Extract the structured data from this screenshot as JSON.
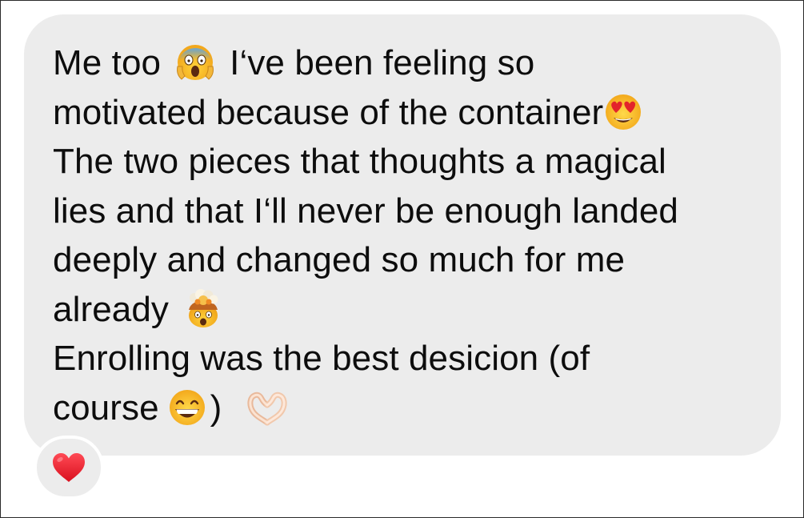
{
  "message": {
    "lines": [
      {
        "before": "Me too",
        "after": "I‘ve been feeling so"
      },
      {
        "text": "motivated because of the container"
      },
      {
        "text": "The two pieces that thoughts a magical"
      },
      {
        "text": "lies and that I‘ll never be enough landed"
      },
      {
        "text": "deeply and changed so much for me"
      },
      {
        "text": "already"
      },
      {
        "text": "Enrolling was the best desicion (of"
      },
      {
        "before": "course",
        "after": ")"
      }
    ],
    "emojis": {
      "line1": "screaming-face-emoji",
      "line2": "heart-eyes-emoji",
      "line6": "exploding-head-emoji",
      "line8_a": "grinning-face-emoji",
      "line8_b": "heart-hands-emoji"
    }
  },
  "reaction": {
    "icon": "red-heart-icon",
    "color": "#e8192c"
  },
  "colors": {
    "bubble": "#ececec",
    "text": "#0d0d0d",
    "background": "#ffffff"
  }
}
